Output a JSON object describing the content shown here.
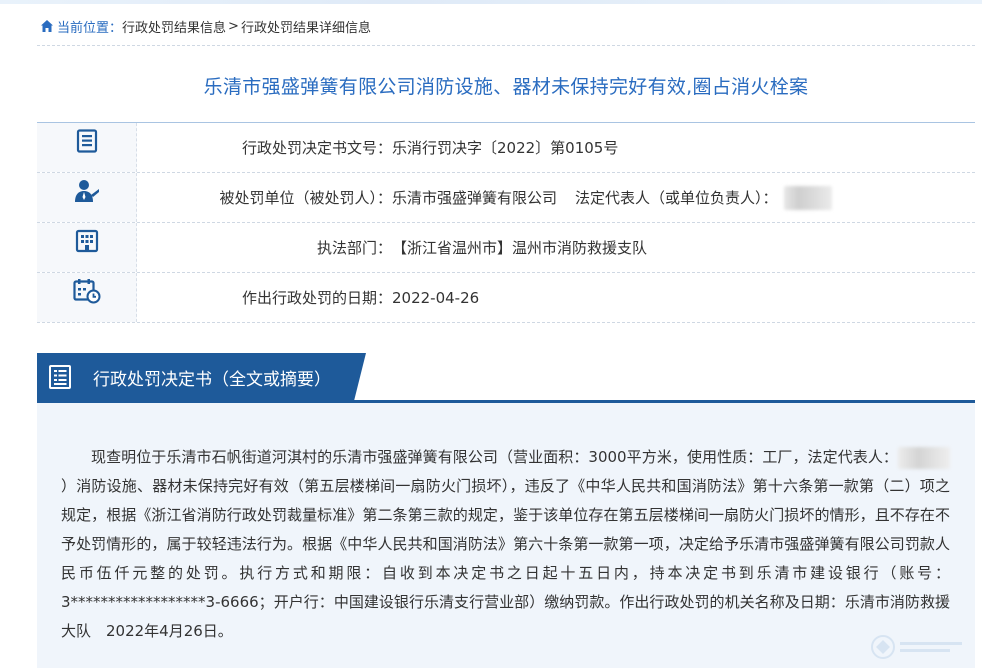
{
  "breadcrumb": {
    "prefix": "当前位置：",
    "items": [
      "行政处罚结果信息",
      "行政处罚结果详细信息"
    ],
    "separator": ">"
  },
  "case_title": "乐清市强盛弹簧有限公司消防设施、器材未保持完好有效,圈占消火栓案",
  "info_rows": [
    {
      "icon": "document-icon",
      "label": "行政处罚决定书文号：",
      "value": "乐消行罚决字〔2022〕第0105号"
    },
    {
      "icon": "person-icon",
      "label": "被处罚单位（被处罚人）：",
      "value": "乐清市强盛弹簧有限公司",
      "label2": "法定代表人（或单位负责人）："
    },
    {
      "icon": "building-icon",
      "label": "执法部门：",
      "value": "【浙江省温州市】温州市消防救援支队"
    },
    {
      "icon": "calendar-icon",
      "label": "作出行政处罚的日期：",
      "value": "2022-04-26"
    }
  ],
  "section": {
    "icon": "list-document-icon",
    "title": "行政处罚决定书（全文或摘要）"
  },
  "decision_text": {
    "part1": "现查明位于乐清市石帆街道河淇村的乐清市强盛弹簧有限公司（营业面积：3000平方米，使用性质：工厂，法定代表人：",
    "part2": "）消防设施、器材未保持完好有效（第五层楼梯间一扇防火门损坏），违反了《中华人民共和国消防法》第十六条第一款第（二）项之规定，根据《浙江省消防行政处罚裁量标准》第二条第三款的规定，鉴于该单位存在第五层楼梯间一扇防火门损坏的情形，且不存在不予处罚情形的，属于较轻违法行为。根据《中华人民共和国消防法》第六十条第一款第一项，决定给予乐清市强盛弹簧有限公司罚款人民币伍仟元整的处罚。执行方式和期限：自收到本决定书之日起十五日内，持本决定书到乐清市建设银行（账号：3******************3-6666；开户行：中国建设银行乐清支行营业部）缴纳罚款。作出行政处罚的机关名称及日期：乐清市消防救援大队　2022年4月26日。"
  },
  "colors": {
    "accent": "#2a6cc0",
    "section_bg": "#1e5a9a",
    "content_bg": "#f0f5fb"
  }
}
